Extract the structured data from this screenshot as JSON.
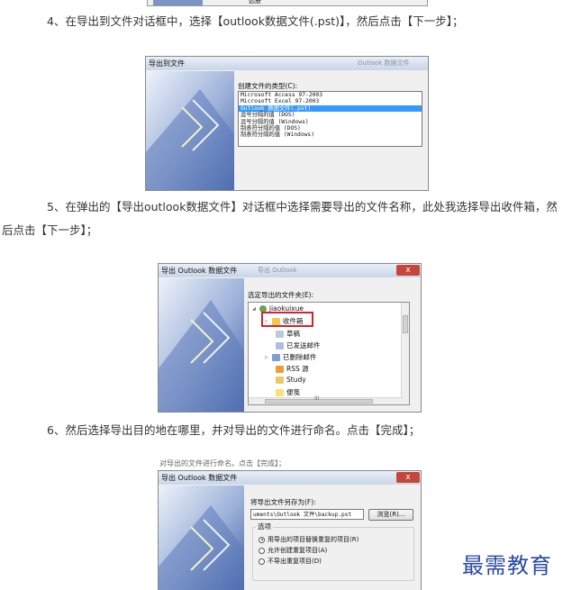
{
  "steps": {
    "step4": "4、在导出到文件对话框中，选择【outlook数据文件(.pst)】，然后点击【下一步】；",
    "step5_line1": "5、在弹出的【导出outlook数据文件】对话框中选择需要导出的文件名称，此处我选择导出收件箱，然",
    "step5_line2": "后点击【下一步】；",
    "step6": "6、然后选择导出目的地在哪里，并对导出的文件进行命名。点击【完成】；"
  },
  "top_fragment": {
    "word": "选册"
  },
  "dialog1": {
    "title": "导出到文件",
    "ghost": "Outlook 数据文件",
    "prompt": "创建文件的类型(C):",
    "file_types": [
      "Microsoft Access 97-2003",
      "Microsoft Excel 97-2003",
      "Outlook 数据文件(.pst)",
      "逗号分隔的值 (DOS)",
      "逗号分隔的值 (Windows)",
      "制表符分隔的值 (DOS)",
      "制表符分隔的值 (Windows)"
    ],
    "selected_index": 2
  },
  "dialog2": {
    "title": "导出 Outlook 数据文件",
    "ghost": "导出 Outlook",
    "prompt": "选定导出的文件夹(E):",
    "close": "x",
    "tree": {
      "root": "jiaokuixue",
      "folders": [
        "收件箱",
        "草稿",
        "已发送邮件",
        "已删除邮件",
        "RSS 源",
        "Study",
        "便笺"
      ]
    },
    "scroll_grip": "III"
  },
  "dialog3": {
    "above_text": "对导出的文件进行命名。点击【完成】；",
    "title": "导出 Outlook 数据文件",
    "close": "x",
    "prompt": "将导出文件另存为(F):",
    "path": "uments\\Outlook 文件\\backup.pst",
    "browse": "浏览(R)...",
    "options_label": "选项",
    "options": [
      "用导出的项目替换重复的项目(R)",
      "允许创建重复项目(A)",
      "不导出重复项目(D)"
    ],
    "selected_option": 0
  },
  "watermark": "最需教育"
}
